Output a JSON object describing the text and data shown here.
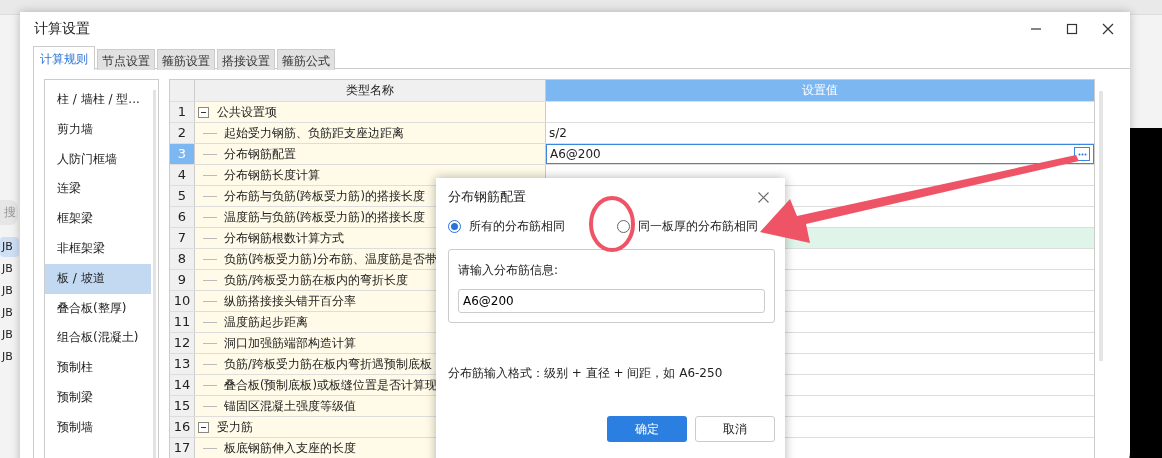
{
  "background_app": {
    "search_label": "搜",
    "list_items": [
      {
        "label": "JB",
        "selected": true
      },
      {
        "label": "JB",
        "selected": false
      },
      {
        "label": "JB",
        "selected": false
      },
      {
        "label": "JB",
        "selected": false
      },
      {
        "label": "JB",
        "selected": false
      },
      {
        "label": "JB",
        "selected": false
      }
    ]
  },
  "window": {
    "title": "计算设置"
  },
  "tabs": [
    {
      "label": "计算规则",
      "selected": true
    },
    {
      "label": "节点设置",
      "selected": false
    },
    {
      "label": "箍筋设置",
      "selected": false
    },
    {
      "label": "搭接设置",
      "selected": false
    },
    {
      "label": "箍筋公式",
      "selected": false
    }
  ],
  "sidebar": {
    "items": [
      {
        "label": "柱 / 墙柱 / 型...",
        "selected": false
      },
      {
        "label": "剪力墙",
        "selected": false
      },
      {
        "label": "人防门框墙",
        "selected": false
      },
      {
        "label": "连梁",
        "selected": false
      },
      {
        "label": "框架梁",
        "selected": false
      },
      {
        "label": "非框架梁",
        "selected": false
      },
      {
        "label": "板 / 坡道",
        "selected": true
      },
      {
        "label": "叠合板(整厚)",
        "selected": false
      },
      {
        "label": "组合板(混凝土)",
        "selected": false
      },
      {
        "label": "预制柱",
        "selected": false
      },
      {
        "label": "预制梁",
        "selected": false
      },
      {
        "label": "预制墙",
        "selected": false
      }
    ]
  },
  "table": {
    "columns": [
      "类型名称",
      "设置值"
    ],
    "rows": [
      {
        "no": "1",
        "name": "公共设置项",
        "expanded": true,
        "selected": false,
        "children": [
          {
            "no": "2",
            "name": "起始受力钢筋、负筋距支座边距离",
            "value": "s/2",
            "selected": false,
            "highlighted": false
          },
          {
            "no": "3",
            "name": "分布钢筋配置",
            "value": "A6@200",
            "selected": true,
            "highlighted": false
          },
          {
            "no": "4",
            "name": "分布钢筋长度计算",
            "selected": false,
            "highlighted": false
          },
          {
            "no": "5",
            "name": "分布筋与负筋(跨板受力筋)的搭接长度",
            "selected": false,
            "highlighted": false
          },
          {
            "no": "6",
            "name": "温度筋与负筋(跨板受力筋)的搭接长度",
            "selected": false,
            "highlighted": false
          },
          {
            "no": "7",
            "name": "分布钢筋根数计算方式",
            "selected": false,
            "highlighted": true
          },
          {
            "no": "8",
            "name": "负筋(跨板受力筋)分布筋、温度筋是否带",
            "selected": false,
            "highlighted": false
          },
          {
            "no": "9",
            "name": "负筋/跨板受力筋在板内的弯折长度",
            "selected": false,
            "highlighted": false
          },
          {
            "no": "10",
            "name": "纵筋搭接接头错开百分率",
            "selected": false,
            "highlighted": false
          },
          {
            "no": "11",
            "name": "温度筋起步距离",
            "selected": false,
            "highlighted": false
          },
          {
            "no": "12",
            "name": "洞口加强筋端部构造计算",
            "selected": false,
            "highlighted": false
          },
          {
            "no": "13",
            "name": "负筋/跨板受力筋在板内弯折遇预制底板",
            "selected": false,
            "highlighted": false
          },
          {
            "no": "14",
            "name": "叠合板(预制底板)或板缝位置是否计算现",
            "selected": false,
            "highlighted": false
          },
          {
            "no": "15",
            "name": "锚固区混凝土强度等级值",
            "selected": false,
            "highlighted": false
          }
        ]
      },
      {
        "no": "16",
        "name": "受力筋",
        "expanded": true,
        "selected": false,
        "children": [
          {
            "no": "17",
            "name": "板底钢筋伸入支座的长度",
            "selected": false,
            "highlighted": false
          }
        ]
      }
    ]
  },
  "dialog": {
    "title": "分布钢筋配置",
    "options": [
      {
        "label": "所有的分布筋相同",
        "selected": true
      },
      {
        "label": "同一板厚的分布筋相同",
        "selected": false
      }
    ],
    "group_label": "请输入分布筋信息:",
    "input_value": "A6@200",
    "hint": "分布筋输入格式：级别 + 直径 + 间距，如 A6-250",
    "buttons": [
      {
        "label": "确定",
        "kind": "primary"
      },
      {
        "label": "取消",
        "kind": "secondary"
      }
    ]
  }
}
